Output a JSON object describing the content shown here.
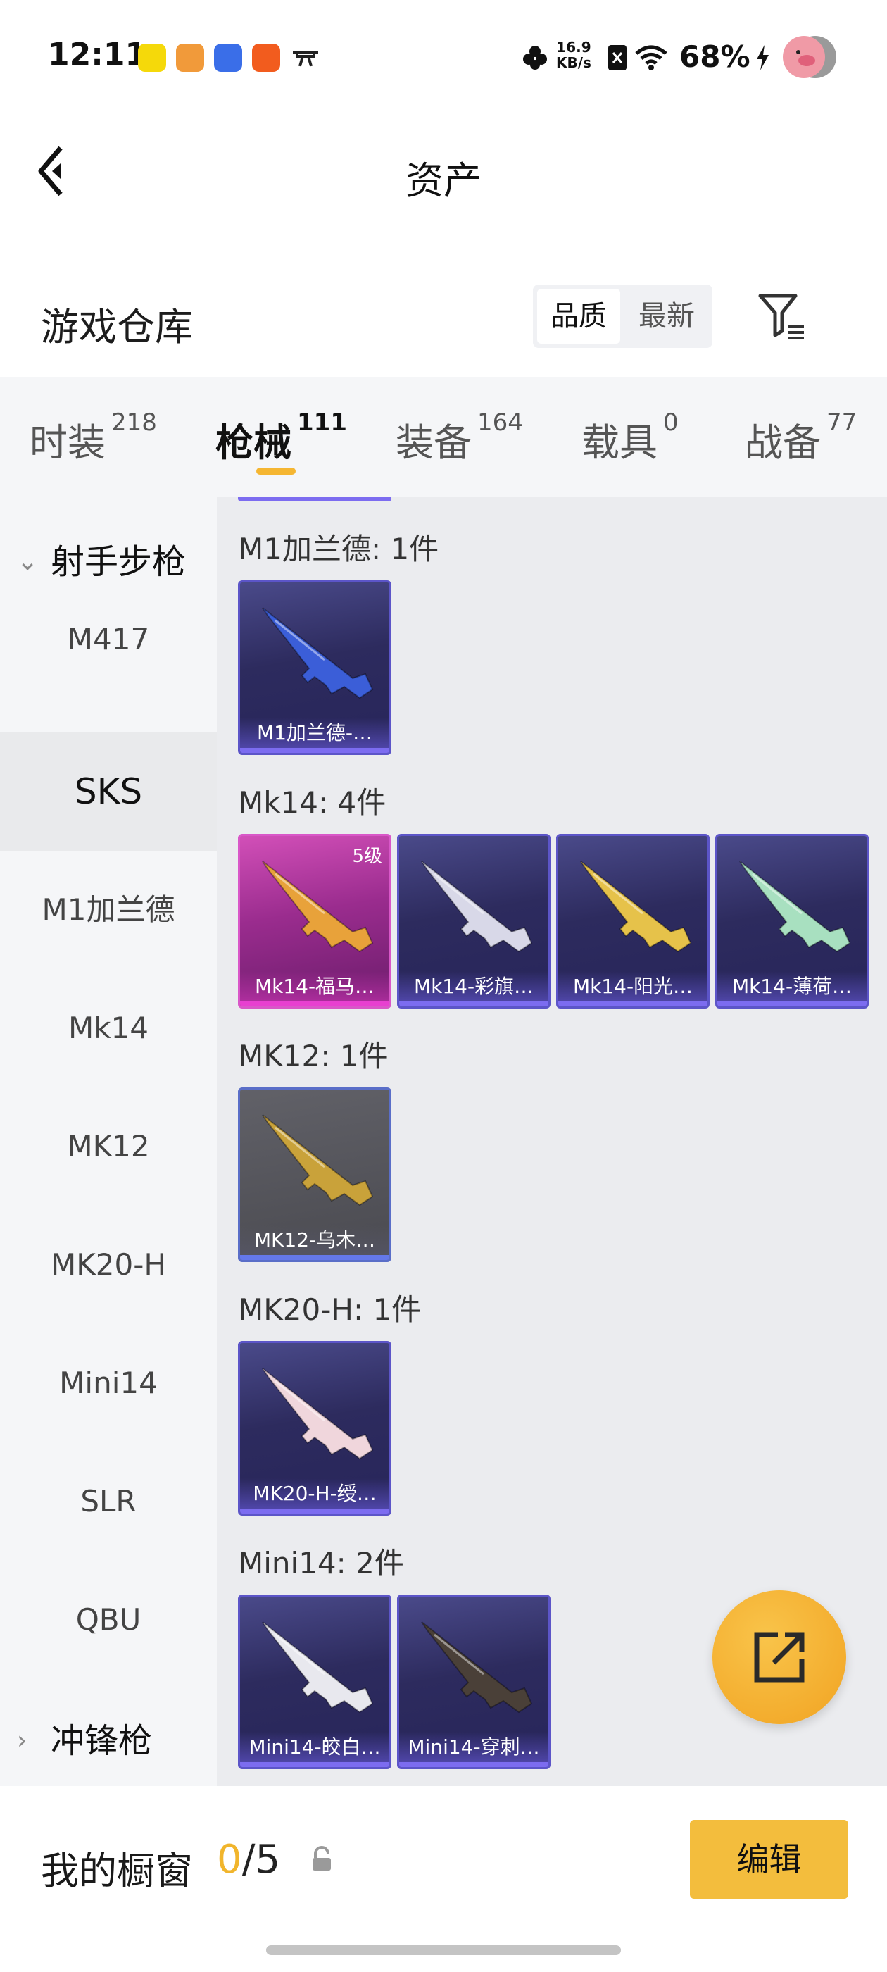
{
  "status_bar": {
    "time": "12:11",
    "speed_value": "16.9",
    "speed_unit": "KB/s",
    "battery": "68%"
  },
  "header": {
    "title": "资产"
  },
  "warehouse": {
    "title": "游戏仓库",
    "sort_options": [
      "品质",
      "最新"
    ],
    "selected_sort": "品质"
  },
  "tabs": [
    {
      "label": "时装",
      "count": "218"
    },
    {
      "label": "枪械",
      "count": "111"
    },
    {
      "label": "装备",
      "count": "164"
    },
    {
      "label": "载具",
      "count": "0"
    },
    {
      "label": "战备",
      "count": "77"
    }
  ],
  "active_tab": "枪械",
  "sidebar": {
    "category_open": "射手步枪",
    "items": [
      "M417",
      "SKS",
      "M1加兰德",
      "Mk14",
      "MK12",
      "MK20-H",
      "Mini14",
      "SLR",
      "QBU"
    ],
    "active_item": "SKS",
    "category_closed": "冲锋枪"
  },
  "groups": [
    {
      "title": "M1加兰德: 1件",
      "items": [
        {
          "name": "M1加兰德-…",
          "level": "",
          "rarity": "purple",
          "gun_color": "#3b5ed8"
        }
      ]
    },
    {
      "title": "Mk14: 4件",
      "items": [
        {
          "name": "Mk14-福马…",
          "level": "5级",
          "rarity": "pink",
          "gun_color": "#e8a23a"
        },
        {
          "name": "Mk14-彩旗…",
          "level": "",
          "rarity": "purple",
          "gun_color": "#d8d8e8"
        },
        {
          "name": "Mk14-阳光…",
          "level": "",
          "rarity": "purple",
          "gun_color": "#e6c24a"
        },
        {
          "name": "Mk14-薄荷…",
          "level": "",
          "rarity": "purple",
          "gun_color": "#a8e0c0"
        }
      ]
    },
    {
      "title": "MK12: 1件",
      "items": [
        {
          "name": "MK12-乌木…",
          "level": "",
          "rarity": "gray",
          "gun_color": "#c9a23a"
        }
      ]
    },
    {
      "title": "MK20-H: 1件",
      "items": [
        {
          "name": "MK20-H-绶…",
          "level": "",
          "rarity": "purple",
          "gun_color": "#f0d6dc"
        }
      ]
    },
    {
      "title": "Mini14: 2件",
      "items": [
        {
          "name": "Mini14-皎白…",
          "level": "",
          "rarity": "purple",
          "gun_color": "#e8e8ee"
        },
        {
          "name": "Mini14-穿刺…",
          "level": "",
          "rarity": "purple",
          "gun_color": "#4a4038"
        }
      ]
    }
  ],
  "bottom_bar": {
    "showcase_label": "我的橱窗",
    "showcase_current": "0",
    "showcase_total": "/5",
    "edit_label": "编辑"
  },
  "colors": {
    "accent": "#f3bd3d",
    "purple_rarity": "#7c6cf0",
    "pink_rarity": "#e83fd0"
  }
}
